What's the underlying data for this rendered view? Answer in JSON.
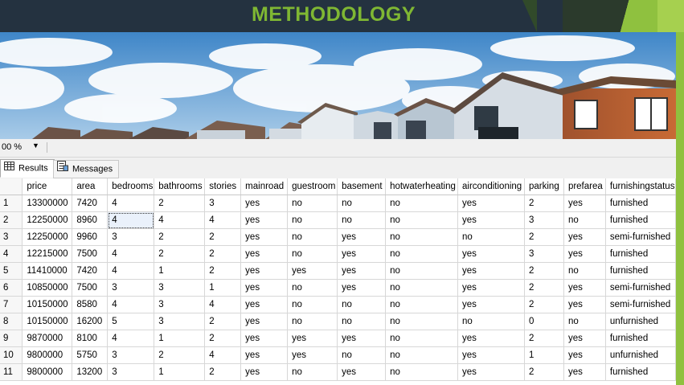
{
  "slide": {
    "title": "METHODOLOGY",
    "accent_color": "#7fb733",
    "header_bg": "#243240"
  },
  "banner": {
    "icon": "photo-houses"
  },
  "ssms": {
    "zoom": "00 %",
    "zoom_dropdown_icon": "chevron-down-icon",
    "tabs": [
      {
        "label": "Results",
        "icon": "grid-icon"
      },
      {
        "label": "Messages",
        "icon": "messages-icon"
      }
    ],
    "columns": [
      "price",
      "area",
      "bedrooms",
      "bathrooms",
      "stories",
      "mainroad",
      "guestroom",
      "basement",
      "hotwaterheating",
      "airconditioning",
      "parking",
      "prefarea",
      "furnishingstatus"
    ],
    "rows": [
      [
        "1",
        "13300000",
        "7420",
        "4",
        "2",
        "3",
        "yes",
        "no",
        "no",
        "no",
        "yes",
        "2",
        "yes",
        "furnished"
      ],
      [
        "2",
        "12250000",
        "8960",
        "4",
        "4",
        "4",
        "yes",
        "no",
        "no",
        "no",
        "yes",
        "3",
        "no",
        "furnished"
      ],
      [
        "3",
        "12250000",
        "9960",
        "3",
        "2",
        "2",
        "yes",
        "no",
        "yes",
        "no",
        "no",
        "2",
        "yes",
        "semi-furnished"
      ],
      [
        "4",
        "12215000",
        "7500",
        "4",
        "2",
        "2",
        "yes",
        "no",
        "yes",
        "no",
        "yes",
        "3",
        "yes",
        "furnished"
      ],
      [
        "5",
        "11410000",
        "7420",
        "4",
        "1",
        "2",
        "yes",
        "yes",
        "yes",
        "no",
        "yes",
        "2",
        "no",
        "furnished"
      ],
      [
        "6",
        "10850000",
        "7500",
        "3",
        "3",
        "1",
        "yes",
        "no",
        "yes",
        "no",
        "yes",
        "2",
        "yes",
        "semi-furnished"
      ],
      [
        "7",
        "10150000",
        "8580",
        "4",
        "3",
        "4",
        "yes",
        "no",
        "no",
        "no",
        "yes",
        "2",
        "yes",
        "semi-furnished"
      ],
      [
        "8",
        "10150000",
        "16200",
        "5",
        "3",
        "2",
        "yes",
        "no",
        "no",
        "no",
        "no",
        "0",
        "no",
        "unfurnished"
      ],
      [
        "9",
        "9870000",
        "8100",
        "4",
        "1",
        "2",
        "yes",
        "yes",
        "yes",
        "no",
        "yes",
        "2",
        "yes",
        "furnished"
      ],
      [
        "10",
        "9800000",
        "5750",
        "3",
        "2",
        "4",
        "yes",
        "yes",
        "no",
        "no",
        "yes",
        "1",
        "yes",
        "unfurnished"
      ],
      [
        "11",
        "9800000",
        "13200",
        "3",
        "1",
        "2",
        "yes",
        "no",
        "yes",
        "no",
        "yes",
        "2",
        "yes",
        "furnished"
      ]
    ],
    "selected_cell": {
      "row": 1,
      "col": "bedrooms"
    }
  }
}
